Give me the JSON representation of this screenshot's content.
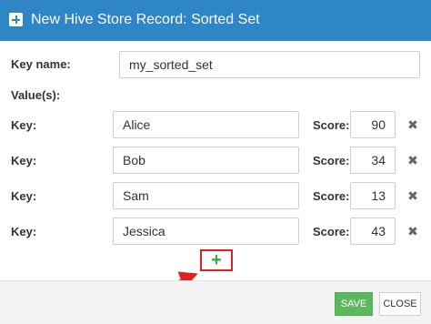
{
  "dialog": {
    "title": "New Hive Store Record: Sorted Set",
    "title_icon": "plus-square-icon"
  },
  "form": {
    "key_name_label": "Key name:",
    "key_name_value": "my_sorted_set",
    "values_label": "Value(s):",
    "key_label": "Key:",
    "score_label": "Score:",
    "rows": [
      {
        "key": "Alice",
        "score": "90"
      },
      {
        "key": "Bob",
        "score": "34"
      },
      {
        "key": "Sam",
        "score": "13"
      },
      {
        "key": "Jessica",
        "score": "43"
      }
    ],
    "add_label": "+",
    "remove_icon": "close-icon",
    "remove_glyph": "✖"
  },
  "footer": {
    "save_label": "SAVE",
    "close_label": "CLOSE"
  },
  "colors": {
    "titlebar": "#2e86c6",
    "save_button": "#5cb85c",
    "add_glyph": "#3aa84a",
    "annotation": "#e02020"
  }
}
